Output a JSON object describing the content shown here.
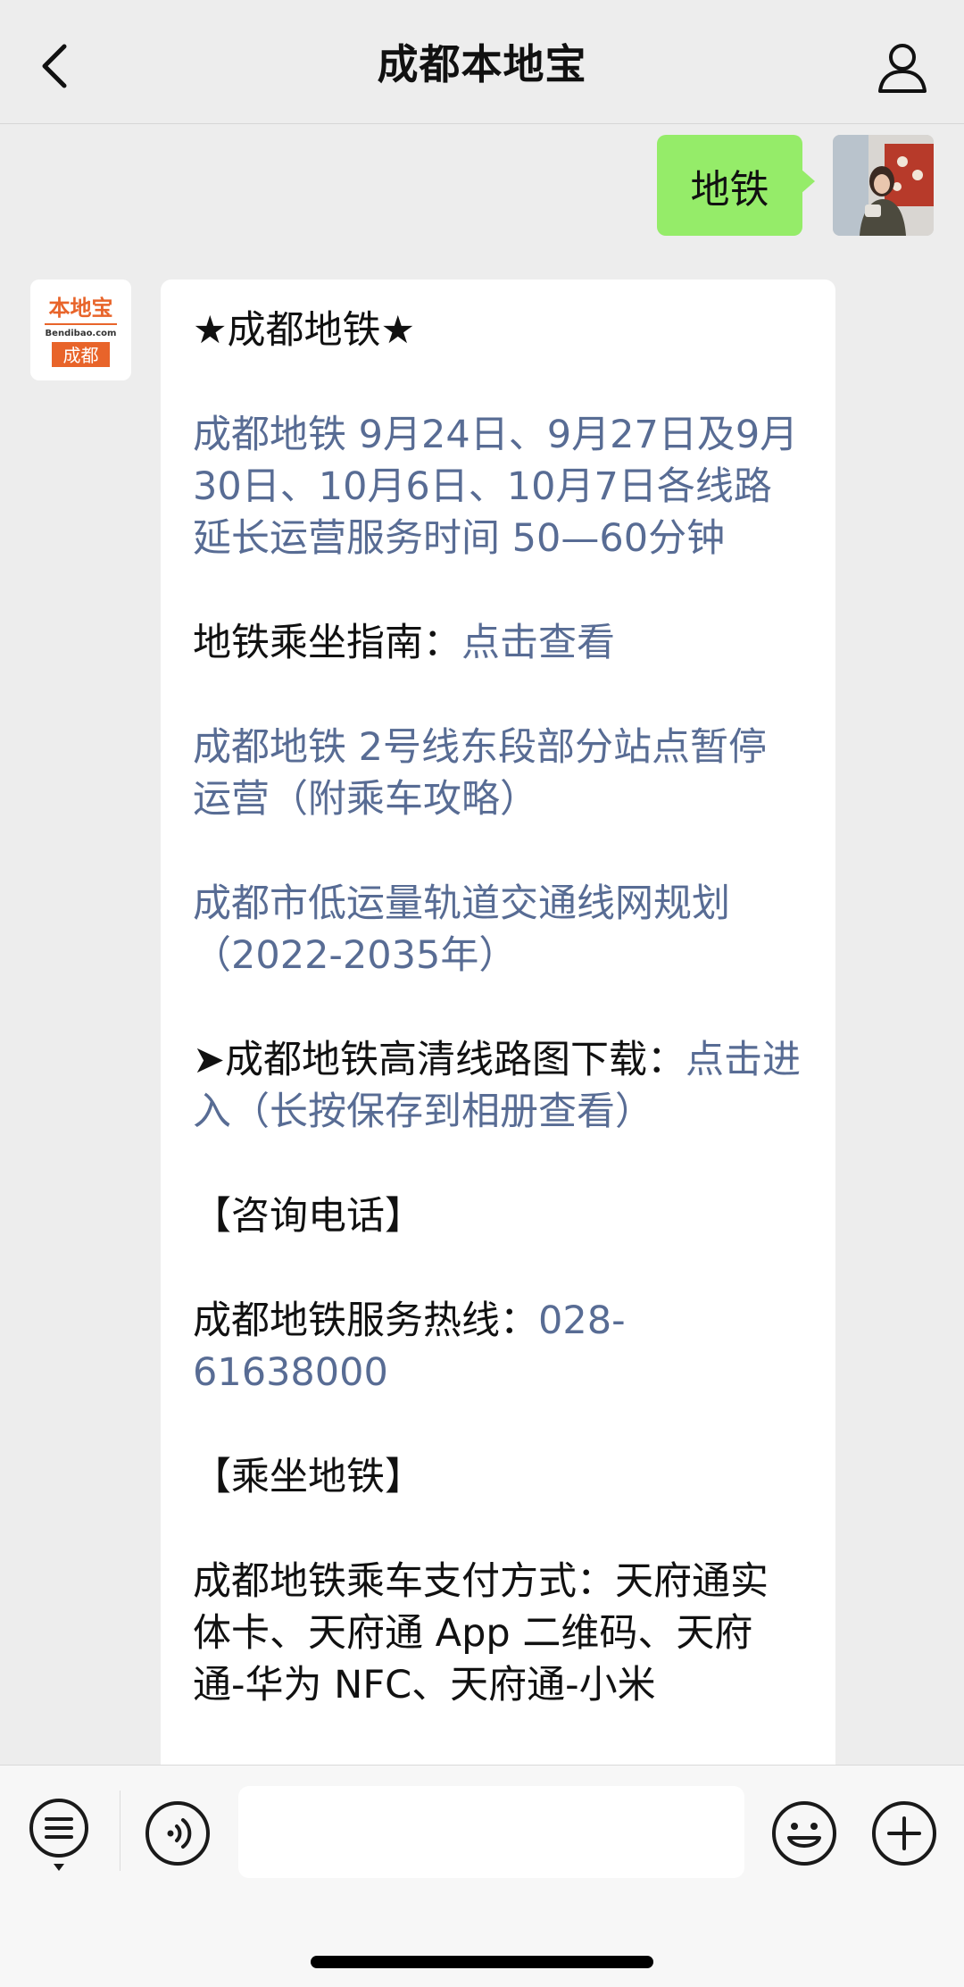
{
  "header": {
    "title": "成都本地宝"
  },
  "outgoing": {
    "text": "地铁"
  },
  "bot_avatar": {
    "brand": "本地宝",
    "domain": "Bendibao.com",
    "city": "成都"
  },
  "message": {
    "heading": "★成都地铁★",
    "p1_link": "成都地铁 9月24日、9月27日及9月30日、10月6日、10月7日各线路延长运营服务时间 50—60分钟",
    "p2_label": "地铁乘坐指南：",
    "p2_link": "点击查看",
    "p3_link": "成都地铁 2号线东段部分站点暂停运营（附乘车攻略）",
    "p4_link": "成都市低运量轨道交通线网规划（2022-2035年）",
    "p5_label": "➤成都地铁高清线路图下载：",
    "p5_link": "点击进入（长按保存到相册查看）",
    "p6": "【咨询电话】",
    "p7_label": "成都地铁服务热线：",
    "p7_link": "028-61638000",
    "p8": "【乘坐地铁】",
    "p9": "成都地铁乘车支付方式：天府通实体卡、天府通 App 二维码、天府通-华为 NFC、天府通-小米"
  },
  "colors": {
    "link": "#586c94",
    "outgoing_bubble": "#95ec69",
    "brand_orange": "#e8642a"
  }
}
